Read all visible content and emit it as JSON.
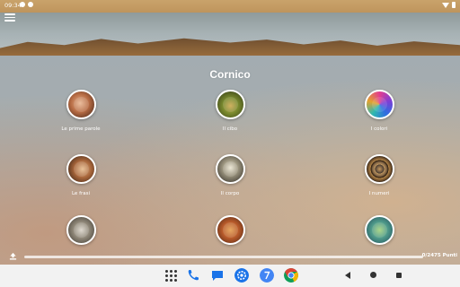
{
  "status_bar": {
    "time": "09:34",
    "left_icons": [
      "sim-icon",
      "notification-icon"
    ],
    "right_icons": [
      "wifi-icon",
      "battery-icon"
    ]
  },
  "app": {
    "title": "Cornico",
    "menu_icon": "hamburger-menu-icon"
  },
  "categories": [
    {
      "label": "Le prime parole",
      "icon": "baby-face-thumbnail"
    },
    {
      "label": "Il cibo",
      "icon": "food-thumbnail"
    },
    {
      "label": "I colori",
      "icon": "colors-thumbnail"
    },
    {
      "label": "Le frasi",
      "icon": "speaking-thumbnail"
    },
    {
      "label": "Il corpo",
      "icon": "skeleton-thumbnail"
    },
    {
      "label": "I numeri",
      "icon": "numbers-thumbnail"
    },
    {
      "label": "",
      "icon": "animal-thumbnail"
    },
    {
      "label": "",
      "icon": "clothes-thumbnail"
    },
    {
      "label": "",
      "icon": "nature-thumbnail"
    }
  ],
  "progress": {
    "text": "0/2475 Punti",
    "fraction": 0.0
  },
  "taskbar": {
    "apps": [
      "app-drawer-icon",
      "phone-icon",
      "messages-icon",
      "settings-icon",
      "clock-icon",
      "chrome-icon"
    ],
    "nav": [
      "back-icon",
      "home-icon",
      "recents-icon"
    ]
  },
  "colors": {
    "settings_blue": "#1a73e8",
    "chrome_red": "#db4437",
    "chrome_yellow": "#f4b400",
    "chrome_green": "#0f9d58"
  }
}
